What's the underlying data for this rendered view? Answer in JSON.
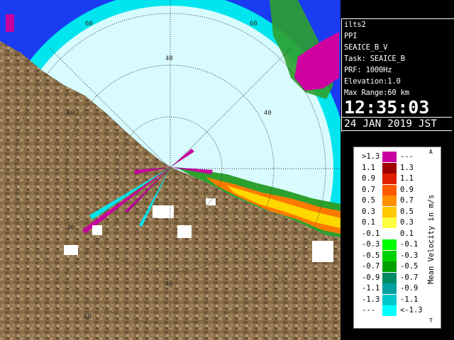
{
  "radar": {
    "range_rings": [
      {
        "label": "20"
      },
      {
        "label": "40"
      },
      {
        "label": "60"
      }
    ]
  },
  "info": {
    "station": "ilts2",
    "mode": "PPI",
    "product": "SEAICE_B_V",
    "task": "Task: SEAICE_B",
    "prf": "PRF: 1000Hz",
    "elevation": "Elevation:1.0",
    "max_range": "Max Range:60 km",
    "time": "12:35:03",
    "date": "24 JAN 2019 JST"
  },
  "legend": {
    "title": "Mean Velocity in m/s",
    "top_mark": "A",
    "bottom_mark": "T",
    "rows": [
      {
        "left": ">1.3",
        "right": "---",
        "color": "#c800a0"
      },
      {
        "left": "1.1",
        "right": "1.3",
        "color": "#a00000"
      },
      {
        "left": "0.9",
        "right": "1.1",
        "color": "#e01e00"
      },
      {
        "left": "0.7",
        "right": "0.9",
        "color": "#ff5a00"
      },
      {
        "left": "0.5",
        "right": "0.7",
        "color": "#ff9000"
      },
      {
        "left": "0.3",
        "right": "0.5",
        "color": "#ffc800"
      },
      {
        "left": "0.1",
        "right": "0.3",
        "color": "#ffff40"
      },
      {
        "left": "-0.1",
        "right": "0.1",
        "color": "#ffffff"
      },
      {
        "left": "-0.3",
        "right": "-0.1",
        "color": "#00ff00"
      },
      {
        "left": "-0.5",
        "right": "-0.3",
        "color": "#00d200"
      },
      {
        "left": "-0.7",
        "right": "-0.5",
        "color": "#00a000"
      },
      {
        "left": "-0.9",
        "right": "-0.7",
        "color": "#008c64"
      },
      {
        "left": "-1.1",
        "right": "-0.9",
        "color": "#00a0a0"
      },
      {
        "left": "-1.3",
        "right": "-1.1",
        "color": "#00c8c8"
      },
      {
        "left": "---",
        "right": "<-1.3",
        "color": "#00ffff"
      }
    ]
  },
  "colors": {
    "land": "#8a6e48",
    "sea_echo": "#00e5ee",
    "clear_sea": "#d8fbfd",
    "outbound": "#1a3cf0"
  }
}
